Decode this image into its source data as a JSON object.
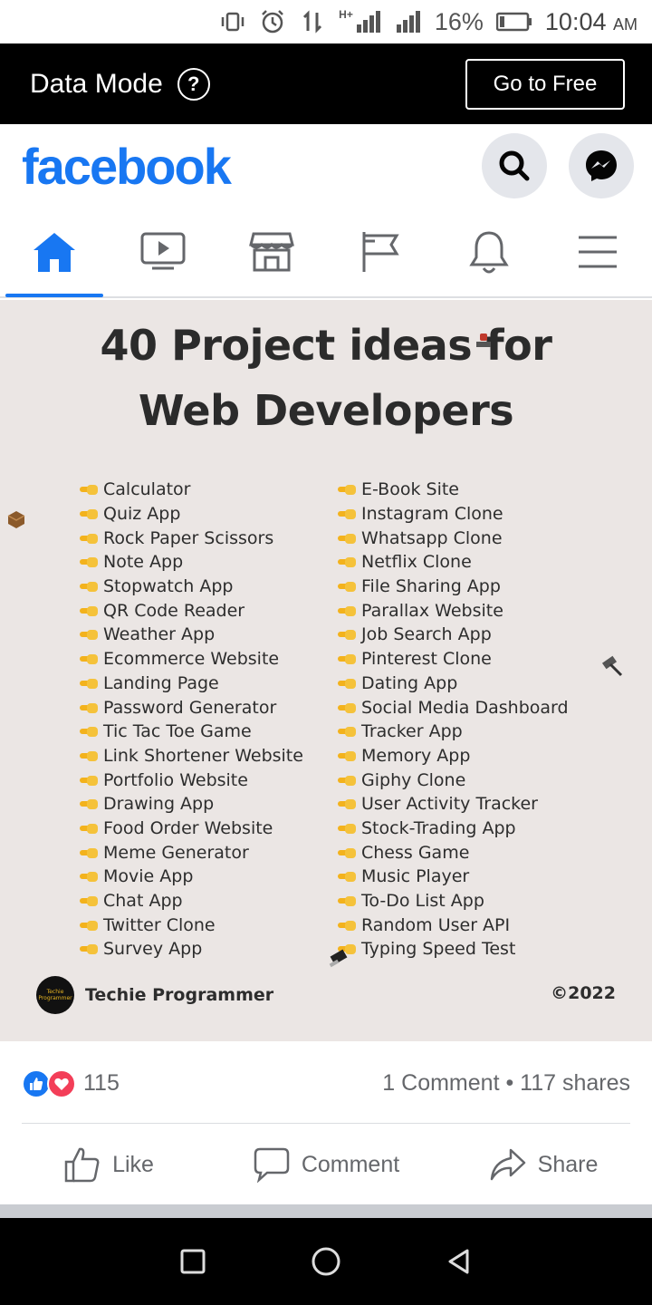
{
  "status_bar": {
    "battery": "16%",
    "time": "10:04",
    "ampm": "AM",
    "network": "H+"
  },
  "data_mode": {
    "title": "Data Mode",
    "button": "Go to Free"
  },
  "header": {
    "logo": "facebook",
    "brand_color": "#1877f2"
  },
  "nav_tabs": [
    {
      "icon": "home-icon",
      "active": true
    },
    {
      "icon": "video-icon",
      "active": false
    },
    {
      "icon": "marketplace-icon",
      "active": false
    },
    {
      "icon": "pages-flag-icon",
      "active": false
    },
    {
      "icon": "bell-icon",
      "active": false
    },
    {
      "icon": "menu-icon",
      "active": false
    }
  ],
  "post": {
    "title_line1": "40 Project ideas for",
    "title_line2": "Web Developers",
    "left_ideas": [
      "Calculator",
      "Quiz App",
      "Rock Paper Scissors",
      "Note App",
      "Stopwatch App",
      "QR Code Reader",
      "Weather App",
      "Ecommerce Website",
      "Landing Page",
      "Password Generator",
      "Tic Tac Toe Game",
      "Link Shortener Website",
      "Portfolio Website",
      "Drawing App",
      "Food Order Website",
      "Meme Generator",
      "Movie App",
      "Chat App",
      "Twitter Clone",
      "Survey App"
    ],
    "right_ideas": [
      "E-Book Site",
      "Instagram Clone",
      "Whatsapp Clone",
      "Netflix Clone",
      "File Sharing App",
      "Parallax Website",
      "Job Search App",
      "Pinterest Clone",
      "Dating App",
      "Social Media Dashboard",
      "Tracker App",
      "Memory App",
      "Giphy Clone",
      "User Activity Tracker",
      "Stock-Trading App",
      "Chess Game",
      "Music Player",
      "To-Do List App",
      "Random User API",
      "Typing Speed Test"
    ],
    "author_avatar_text": "Techie Programmer",
    "author": "Techie Programmer",
    "copyright": "©2022"
  },
  "engagement": {
    "reaction_count": "115",
    "comments_shares": "1 Comment • 117 shares"
  },
  "actions": {
    "like": "Like",
    "comment": "Comment",
    "share": "Share"
  }
}
